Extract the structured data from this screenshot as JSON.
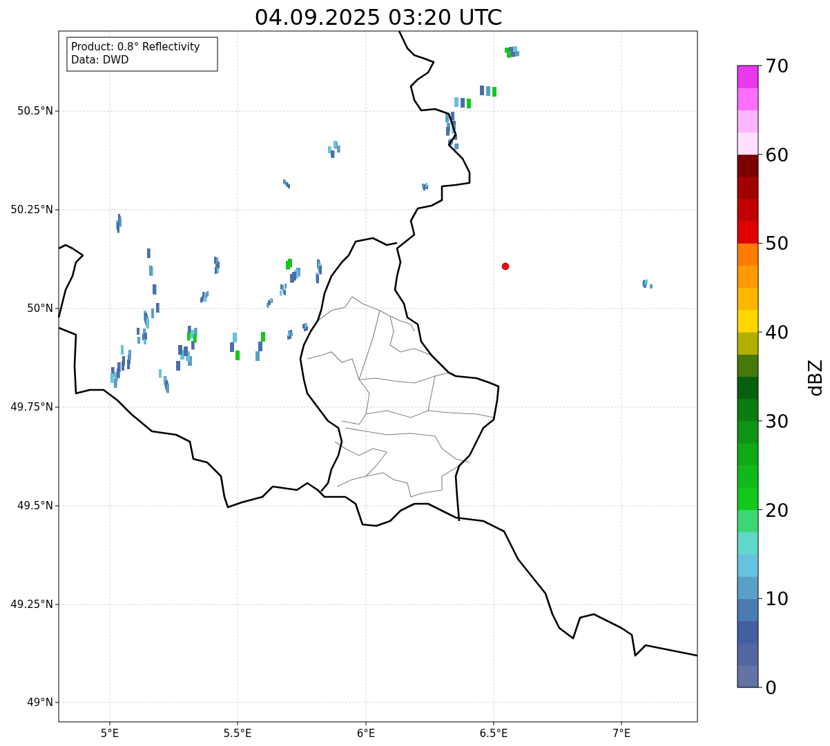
{
  "title": "04.09.2025 03:20 UTC",
  "info_box": [
    "Product: 0.8° Reflectivity",
    "Data: DWD"
  ],
  "x_ticks": [
    "5°E",
    "5.5°E",
    "6°E",
    "6.5°E",
    "7°E"
  ],
  "y_ticks": [
    "50.5°N",
    "50.25°N",
    "50°N",
    "49.75°N",
    "49.5°N",
    "49.25°N",
    "49°N"
  ],
  "colorbar": {
    "label": "dBZ",
    "ticks": [
      "70",
      "60",
      "50",
      "40",
      "30",
      "20",
      "10",
      "0"
    ],
    "segments": [
      {
        "color": "#6472a6"
      },
      {
        "color": "#5366a0"
      },
      {
        "color": "#435fa2"
      },
      {
        "color": "#4a7bb2"
      },
      {
        "color": "#59a0c8"
      },
      {
        "color": "#66c2de"
      },
      {
        "color": "#60d8c8"
      },
      {
        "color": "#3cd674"
      },
      {
        "color": "#12c81c"
      },
      {
        "color": "#10b81a"
      },
      {
        "color": "#0fa816"
      },
      {
        "color": "#0e9414"
      },
      {
        "color": "#0a7c10"
      },
      {
        "color": "#07600e"
      },
      {
        "color": "#46780a"
      },
      {
        "color": "#b0b000"
      },
      {
        "color": "#ffd700"
      },
      {
        "color": "#ffb600"
      },
      {
        "color": "#ff9b00"
      },
      {
        "color": "#ff7e00"
      },
      {
        "color": "#e00000"
      },
      {
        "color": "#c00000"
      },
      {
        "color": "#a00000"
      },
      {
        "color": "#7a0000"
      },
      {
        "color": "#ffe0ff"
      },
      {
        "color": "#ffb4ff"
      },
      {
        "color": "#ff6eff"
      },
      {
        "color": "#e838f0"
      }
    ]
  }
}
